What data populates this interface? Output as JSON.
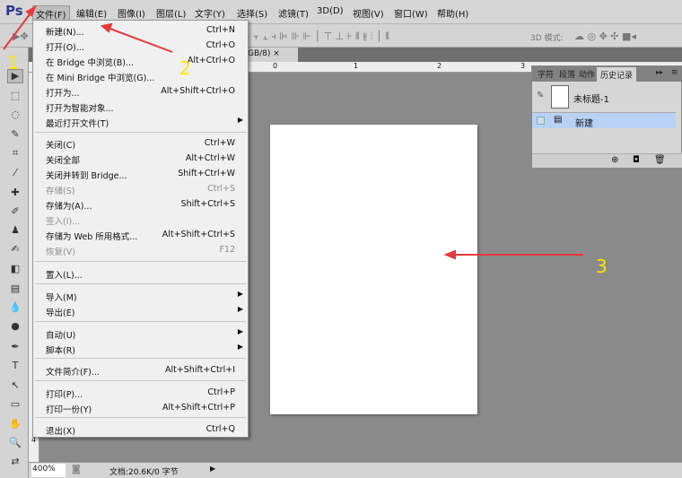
{
  "app": {
    "logo": "Ps"
  },
  "menubar": [
    "文件(F)",
    "编辑(E)",
    "图像(I)",
    "图层(L)",
    "文字(Y)",
    "选择(S)",
    "滤镜(T)",
    "3D(D)",
    "视图(V)",
    "窗口(W)",
    "帮助(H)"
  ],
  "options": {
    "mode_label": "3D 模式:"
  },
  "doc_tab": {
    "label": "GB/8)",
    "close": "×"
  },
  "ruler": {
    "h": [
      "0",
      "1",
      "2",
      "3"
    ],
    "v": [
      "4"
    ]
  },
  "file_menu": [
    {
      "label": "新建(N)...",
      "shortcut": "Ctrl+N"
    },
    {
      "label": "打开(O)...",
      "shortcut": "Ctrl+O"
    },
    {
      "label": "在 Bridge 中浏览(B)...",
      "shortcut": "Alt+Ctrl+O"
    },
    {
      "label": "在 Mini Bridge 中浏览(G)...",
      "shortcut": ""
    },
    {
      "label": "打开为...",
      "shortcut": "Alt+Shift+Ctrl+O"
    },
    {
      "label": "打开为智能对象...",
      "shortcut": ""
    },
    {
      "label": "最近打开文件(T)",
      "shortcut": "",
      "submenu": true
    },
    {
      "label": "关闭(C)",
      "shortcut": "Ctrl+W"
    },
    {
      "label": "关闭全部",
      "shortcut": "Alt+Ctrl+W"
    },
    {
      "label": "关闭并转到 Bridge...",
      "shortcut": "Shift+Ctrl+W"
    },
    {
      "label": "存储(S)",
      "shortcut": "Ctrl+S",
      "disabled": true
    },
    {
      "label": "存储为(A)...",
      "shortcut": "Shift+Ctrl+S"
    },
    {
      "label": "签入(I)...",
      "shortcut": "",
      "disabled": true
    },
    {
      "label": "存储为 Web 所用格式...",
      "shortcut": "Alt+Shift+Ctrl+S"
    },
    {
      "label": "恢复(V)",
      "shortcut": "F12",
      "disabled": true
    },
    {
      "label": "置入(L)...",
      "shortcut": ""
    },
    {
      "label": "导入(M)",
      "shortcut": "",
      "submenu": true
    },
    {
      "label": "导出(E)",
      "shortcut": "",
      "submenu": true
    },
    {
      "label": "自动(U)",
      "shortcut": "",
      "submenu": true
    },
    {
      "label": "脚本(R)",
      "shortcut": "",
      "submenu": true
    },
    {
      "label": "文件简介(F)...",
      "shortcut": "Alt+Shift+Ctrl+I"
    },
    {
      "label": "打印(P)...",
      "shortcut": "Ctrl+P"
    },
    {
      "label": "打印一份(Y)",
      "shortcut": "Alt+Shift+Ctrl+P"
    },
    {
      "label": "退出(X)",
      "shortcut": "Ctrl+Q"
    }
  ],
  "panel": {
    "tabs": [
      "字符",
      "段落",
      "动作",
      "历史记录"
    ],
    "snapshot": "未标题-1",
    "history": [
      "新建"
    ]
  },
  "status": {
    "zoom": "400%",
    "doc": "文档:20.6K/0 字节"
  },
  "annotations": [
    "1",
    "2",
    "3"
  ],
  "colors": {
    "highlight": "#b9d1f5",
    "arrow": "#e8383d",
    "number": "#ffe400"
  }
}
